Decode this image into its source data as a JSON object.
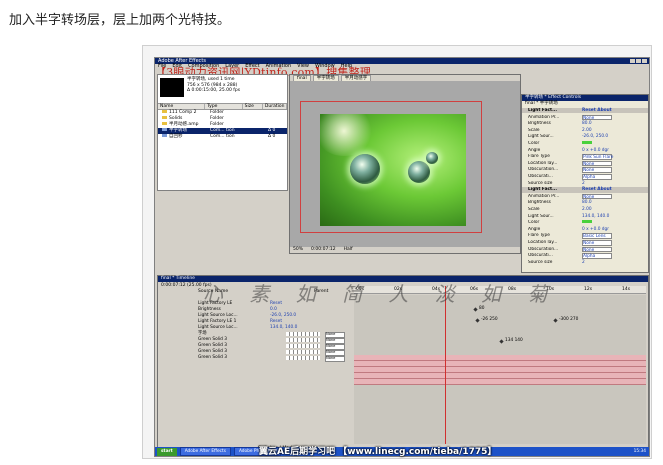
{
  "caption": "加入半字转场层，层上加两个光特技。",
  "app": {
    "title": "Adobe After Effects",
    "menu": [
      "File",
      "Edit",
      "Composition",
      "Layer",
      "Effect",
      "Animation",
      "View",
      "Window",
      "Help"
    ],
    "banner": "【3眼动力资讯网|YDtinfo.com】搜集整理"
  },
  "project": {
    "selected": "半字转场, used 1 time",
    "size": "756 x 576 (984 x 288)",
    "duration": "Δ 0:00:15:00, 25.00 fps",
    "columns": [
      "Name",
      "Type",
      "Size",
      "Duration"
    ],
    "items": [
      {
        "name": "111 Comp 2",
        "type": "Folder",
        "size": "",
        "dur": ""
      },
      {
        "name": "Solids",
        "type": "Folder",
        "size": "",
        "dur": ""
      },
      {
        "name": "半月动感.amp",
        "type": "Folder",
        "size": "",
        "dur": ""
      },
      {
        "name": "半字转场",
        "type": "Com... tion",
        "size": "",
        "dur": "Δ 0"
      },
      {
        "name": "自回秒",
        "type": "Com... tion",
        "size": "",
        "dur": "Δ 0"
      }
    ]
  },
  "comp": {
    "tabs": [
      "final",
      "半字转场",
      "半月动感字"
    ],
    "zoom": "50%",
    "time": "0:00:07:12",
    "res": "Half"
  },
  "effects": {
    "title": "半字转场 * Effect Controls",
    "layer": "final * 半字转场",
    "rows": [
      {
        "label": "Light Fact...",
        "value": "Reset   About",
        "group": true
      },
      {
        "label": "Animation Pr...",
        "value": "None",
        "dd": true
      },
      {
        "label": "Brightness",
        "value": "80.0"
      },
      {
        "label": "Scale",
        "value": "2.00"
      },
      {
        "label": "Light Sour...",
        "value": "-26.0, 250.0"
      },
      {
        "label": "Color",
        "value": "",
        "swatch": true
      },
      {
        "label": "Angle",
        "value": "0 x +0.0 dgr"
      },
      {
        "label": "Flare Type",
        "value": "Pink Sun Flare",
        "dd": true
      },
      {
        "label": "Location lay...",
        "value": "None",
        "dd": true
      },
      {
        "label": "Obscuration...",
        "value": "None",
        "dd": true
      },
      {
        "label": "Obscurati...",
        "value": "Alpha",
        "dd": true
      },
      {
        "label": "Source size",
        "value": "2"
      },
      {
        "label": "Light Fact...",
        "value": "Reset   About",
        "group": true
      },
      {
        "label": "Animation Pr...",
        "value": "None",
        "dd": true
      },
      {
        "label": "Brightness",
        "value": "80.0"
      },
      {
        "label": "Scale",
        "value": "2.00"
      },
      {
        "label": "Light Sour...",
        "value": "134.0, 140.0"
      },
      {
        "label": "Color",
        "value": "",
        "swatch": true
      },
      {
        "label": "Angle",
        "value": "0 x +0.0 dgr"
      },
      {
        "label": "Flare Type",
        "value": "Basic Lens",
        "dd": true
      },
      {
        "label": "Location lay...",
        "value": "None",
        "dd": true
      },
      {
        "label": "Obscuration...",
        "value": "None",
        "dd": true
      },
      {
        "label": "Obscurati...",
        "value": "Alpha",
        "dd": true
      },
      {
        "label": "Source size",
        "value": "2"
      }
    ]
  },
  "timeline": {
    "title": "final * Timeline",
    "time": "0:00:07:12",
    "fps": "(25.00 fps)",
    "ruler": [
      "00s",
      "02s",
      "04s",
      "06s",
      "08s",
      "10s",
      "12s",
      "14s"
    ],
    "col_source": "Source Name",
    "col_parent": "Parent",
    "rows": [
      {
        "name": "Light Factory LE",
        "value": "Reset"
      },
      {
        "name": "Brightness",
        "value": "0.0"
      },
      {
        "name": "Light Source Loc...",
        "value": "-26.0, 250.0"
      },
      {
        "name": "Light Factory LE 1",
        "value": "Reset"
      },
      {
        "name": "Light Source Loc...",
        "value": "134.0, 140.0"
      },
      {
        "name": "字场",
        "value": "",
        "mode": "None"
      },
      {
        "name": "Green Solid 3",
        "value": "",
        "mode": "None"
      },
      {
        "name": "Green Solid 3",
        "value": "",
        "mode": "None"
      },
      {
        "name": "Green Solid 3",
        "value": "",
        "mode": "None"
      },
      {
        "name": "Green Solid 3",
        "value": "",
        "mode": "None"
      }
    ],
    "keys": [
      {
        "label": "80"
      },
      {
        "label": "-26 250"
      },
      {
        "label": "-300 270"
      },
      {
        "label": "134 140"
      }
    ],
    "footer": "Switches / Modes"
  },
  "watermark": "心 素 如 简   人 淡 如 菊",
  "taskbar": {
    "start": "start",
    "tasks": [
      "Adobe After Effects",
      "Adobe Photoshop"
    ],
    "clock": "15:34"
  },
  "footbrand": "翼云AE后期学习吧 【www.linecg.com/tieba/1775】"
}
